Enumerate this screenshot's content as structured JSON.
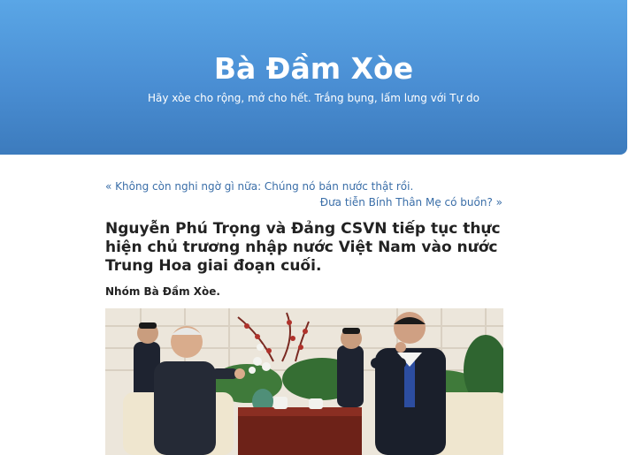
{
  "header": {
    "blog_title": "Bà Đầm Xòe",
    "tagline": "Hãy xòe cho rộng, mở cho hết. Trắng bụng, lấm lưng với Tự do"
  },
  "post_nav": {
    "prev_arrow": "«",
    "prev_label": "Không còn nghi ngờ gì nữa: Chúng nó bán nước thật rồi.",
    "next_label": "Đưa tiễn Bính Thân Mẹ có buồn?",
    "next_arrow": "»"
  },
  "post": {
    "title": "Nguyễn Phú Trọng và Đảng CSVN tiếp tục thực hiện chủ trương nhập nước Việt Nam vào nước Trung Hoa giai đoạn cuối.",
    "byline": "Nhóm Bà Đầm Xòe."
  },
  "colors": {
    "header_top": "#5aa6e6",
    "header_bottom": "#3c7bbd",
    "link": "#3a6ea8",
    "text": "#222222"
  }
}
